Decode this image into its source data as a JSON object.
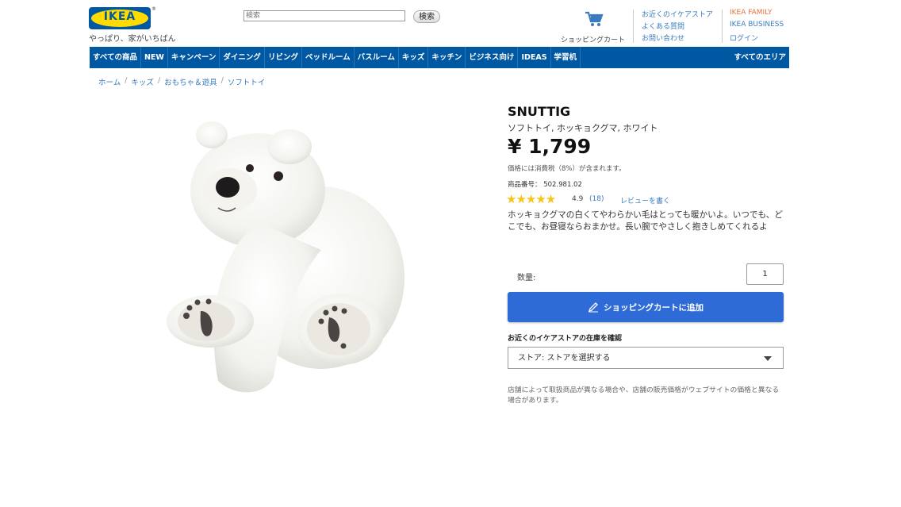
{
  "header": {
    "logo_text": "IKEA",
    "logo_reg": "®",
    "tagline": "やっぱり、家がいちばん",
    "search_placeholder": "検索",
    "search_button": "検索",
    "cart_label": "ショッピングカート",
    "links_col1": [
      "お近くのイケアストア",
      "よくある質問",
      "お問い合わせ"
    ],
    "links_col2": [
      "IKEA FAMILY",
      "IKEA BUSINESS",
      "ログイン"
    ]
  },
  "nav": {
    "items": [
      "すべての商品",
      "NEW",
      "キャンペーン",
      "ダイニング",
      "リビング",
      "ベッドルーム",
      "バスルーム",
      "キッズ",
      "キッチン",
      "ビジネス向け",
      "IDEAS",
      "学習机"
    ],
    "right": "すべてのエリア"
  },
  "breadcrumb": {
    "items": [
      "ホーム",
      "キッズ",
      "おもちゃ＆遊具",
      "ソフトトイ"
    ],
    "separator": "/"
  },
  "product": {
    "name": "SNUTTIG",
    "description": "ソフトトイ, ホッキョクグマ, ホワイト",
    "price": "¥ 1,799",
    "tax_note": "価格には消費税（8%）が含まれます。",
    "item_number": "商品番号： 502.981.02",
    "stars": "★★★★★",
    "rating": "4.9",
    "rating_count": "(18)",
    "review_link": "レビューを書く",
    "blurb": "ホッキョクグマの白くてやわらかい毛はとっても暖かいよ。いつでも、どこでも、お昼寝ならおまかせ。長い腕でやさしく抱きしめてくれるよ",
    "quantity_label": "数量:",
    "quantity_value": "1",
    "add_to_cart": "ショッピングカートに追加",
    "stock_title": "お近くのイケアストアの在庫を確認",
    "store_select": "ストア: ストアを選択する",
    "note": "店舗によって取扱商品が異なる場合や、店舗の販売価格がウェブサイトの価格と異なる場合があります。"
  },
  "colors": {
    "brand_blue": "#0058a3",
    "brand_yellow": "#ffdb00",
    "button_blue": "#2f6bd7",
    "link_blue": "#3a7bbf",
    "star_gold": "#f5c518"
  }
}
